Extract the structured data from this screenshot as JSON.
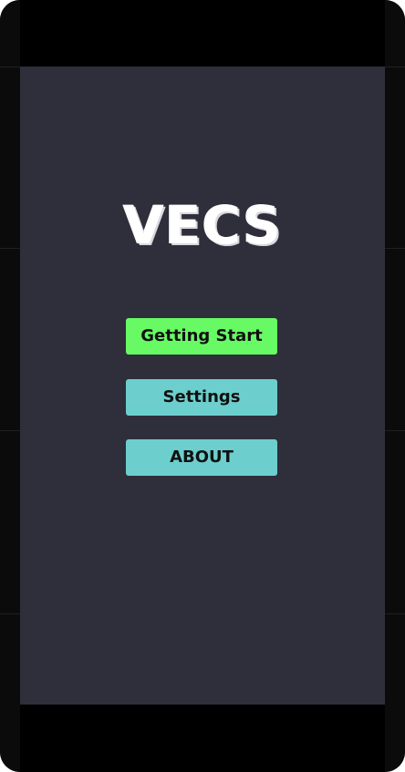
{
  "game": {
    "title": "VECS"
  },
  "menu": {
    "getting_start_label": "Getting Start",
    "settings_label": "Settings",
    "about_label": "ABOUT"
  },
  "colors": {
    "background": "#2f2e3b",
    "primary_button": "#67fa64",
    "secondary_button": "#6ccfcd",
    "title_text": "#ffffff"
  }
}
